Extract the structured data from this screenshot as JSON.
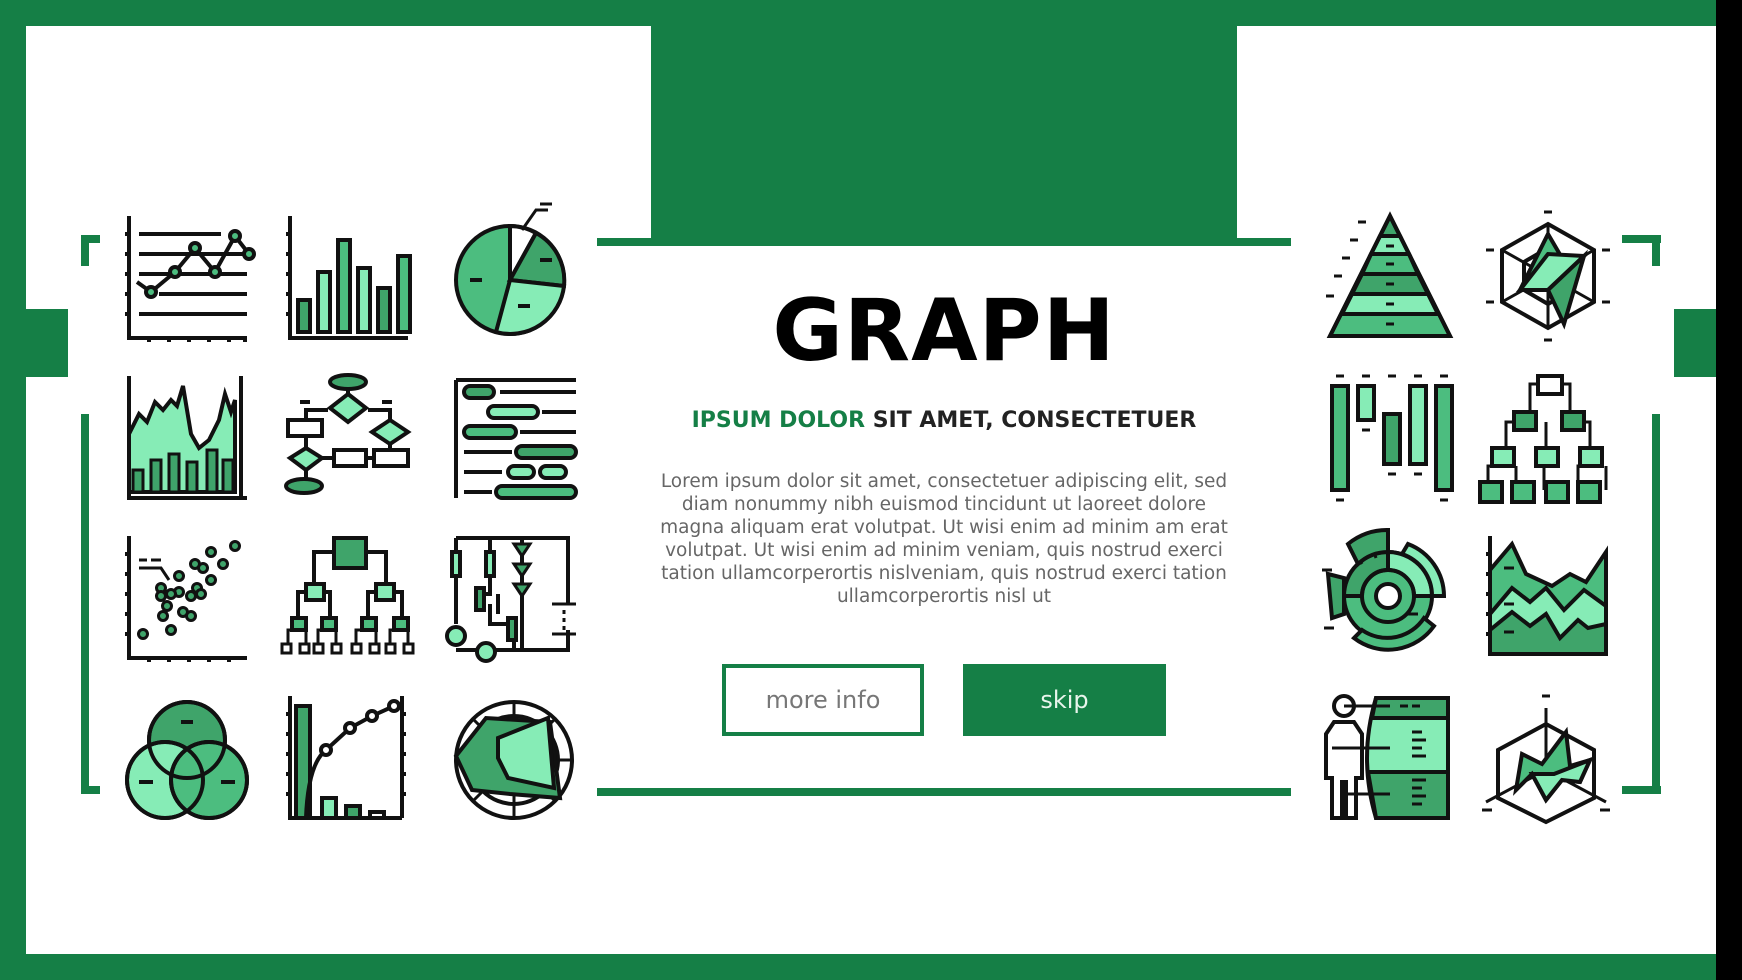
{
  "heading": {
    "title": "GRAPH",
    "subtitle_accent": "IPSUM DOLOR",
    "subtitle_rest": " SIT AMET, CONSECTETUER",
    "body": "Lorem ipsum dolor sit amet, consectetuer adipiscing elit, sed diam nonummy nibh euismod tincidunt ut laoreet dolore magna aliquam erat volutpat. Ut wisi enim ad minim am erat volutpat. Ut wisi enim ad minim veniam, quis nostrud exerci tation ullamcorperortis nislveniam, quis nostrud exerci tation ullamcorperortis nisl ut"
  },
  "buttons": {
    "more_info": "more info",
    "skip": "skip"
  },
  "colors": {
    "brand_green": "#157f46",
    "icon_mid": "#4cbd7f",
    "icon_light": "#86ecb6",
    "icon_dark": "#3fa46a"
  },
  "icons": {
    "left": [
      "line-chart-icon",
      "bar-chart-icon",
      "pie-chart-icon",
      "area-bar-chart-icon",
      "flowchart-icon",
      "gantt-chart-icon",
      "scatter-plot-icon",
      "hierarchy-tree-icon",
      "circuit-diagram-icon",
      "venn-diagram-icon",
      "pareto-chart-icon",
      "polar-radar-chart-icon"
    ],
    "right": [
      "pyramid-chart-icon",
      "hexagon-radar-chart-icon",
      "candlestick-chart-icon",
      "pyramid-tree-icon",
      "sunburst-chart-icon",
      "stacked-area-chart-icon",
      "human-body-infographic-icon",
      "3d-surface-chart-icon"
    ]
  }
}
